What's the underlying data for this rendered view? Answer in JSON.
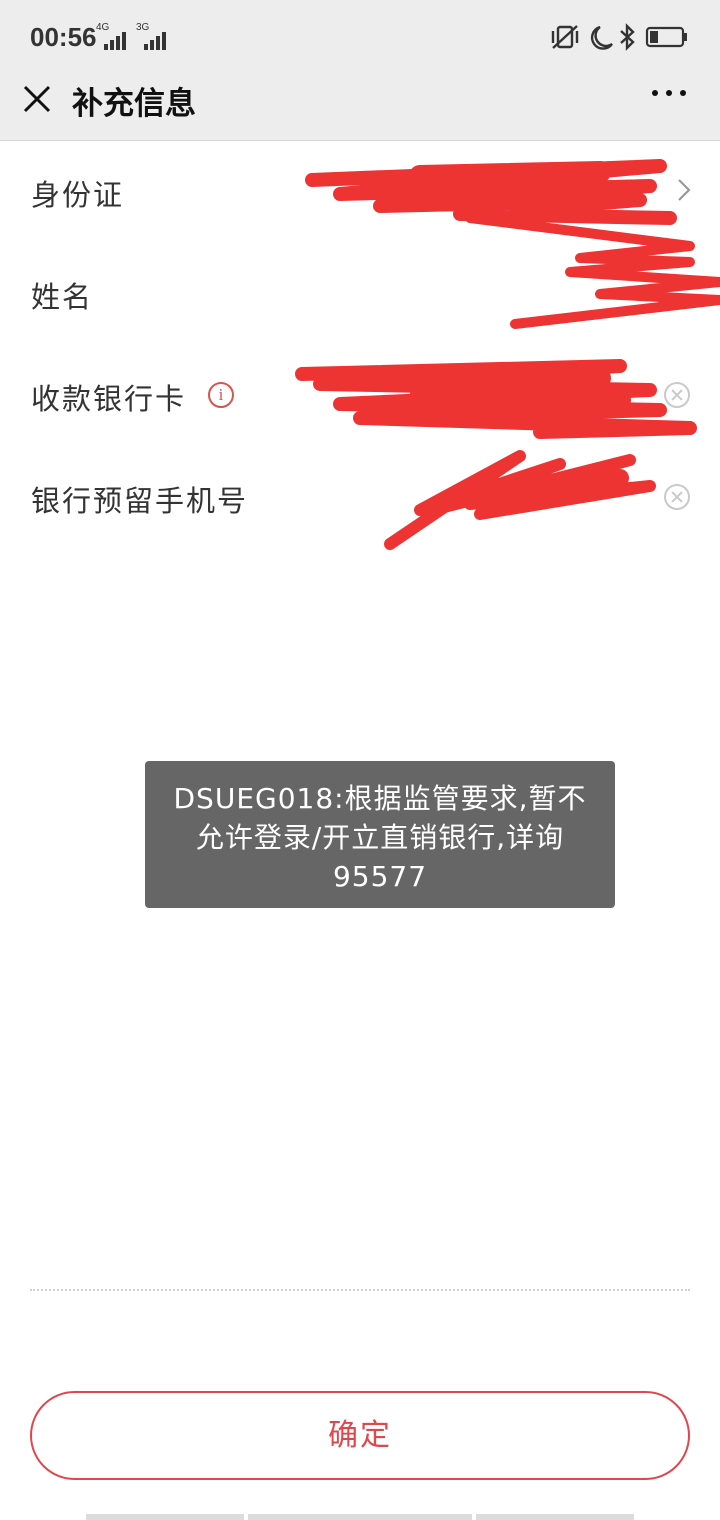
{
  "status_bar": {
    "time": "00:56",
    "signal_1_label": "4G",
    "signal_2_label": "3G",
    "icons": [
      "vibrate-icon",
      "moon-icon",
      "bluetooth-icon",
      "battery-icon"
    ]
  },
  "header": {
    "title": "补充信息",
    "close_icon": "close-icon",
    "more_icon": "more-icon"
  },
  "form": {
    "rows": [
      {
        "label": "身份证",
        "value": "",
        "action_icon": "chevron-right-icon"
      },
      {
        "label": "姓名",
        "value": ""
      },
      {
        "label": "收款银行卡",
        "value": "",
        "info_icon": "info-icon",
        "action_icon": "clear-icon"
      },
      {
        "label": "银行预留手机号",
        "value": "",
        "action_icon": "clear-icon"
      }
    ]
  },
  "toast": {
    "message": "DSUEG018:根据监管要求,暂不允许登录/开立直销银行,详询95577"
  },
  "footer": {
    "confirm_label": "确定"
  },
  "colors": {
    "accent": "#e0474c",
    "header_bg": "#ededed",
    "toast_bg": "#666666",
    "redaction": "#ee3333"
  }
}
